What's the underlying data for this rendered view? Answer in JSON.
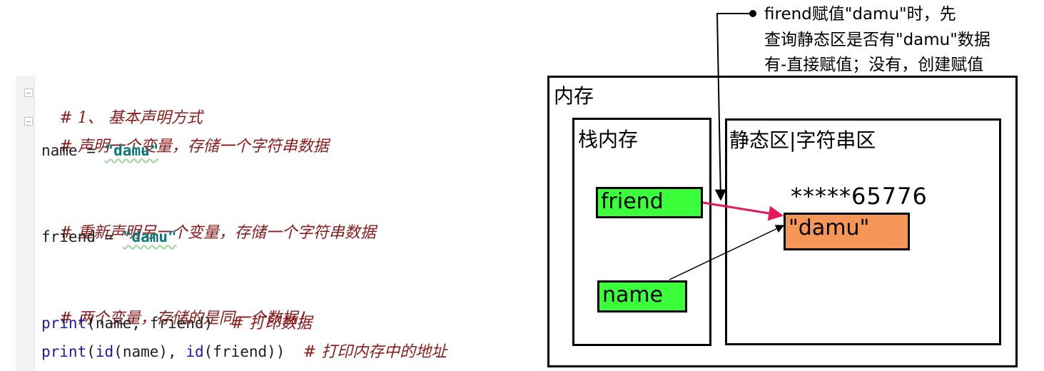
{
  "code": {
    "comment_1": "# 1、 基本声明方式",
    "comment_2": "# 声明一个变量，存储一个字符串数据",
    "line_name": {
      "var": "name",
      "op": " = ",
      "value": "\"damu\""
    },
    "comment_3": "# 重新声明另一个变量，存储一个字符串数据",
    "line_friend": {
      "var": "friend",
      "op": " = ",
      "value": "\"damu\""
    },
    "comment_4": "# 两个变量，存储的是同一个数据！",
    "line_print1": {
      "fn": "print",
      "args": "(name, friend)  ",
      "comment": "# 打印数据"
    },
    "line_print2": {
      "fn": "print",
      "open": "(",
      "fn2": "id",
      "arg1": "(name), ",
      "fn3": "id",
      "arg2": "(friend))  ",
      "comment": "# 打印内存中的地址"
    }
  },
  "diagram": {
    "memory_label": "内存",
    "stack_label": "栈内存",
    "static_label": "静态区|字符串区",
    "var_friend": "friend",
    "var_name": "name",
    "address": "*****65776",
    "value": "\"damu\"",
    "note_lines": [
      "firend赋值\"damu\"时，先",
      "查询静态区是否有\"damu\"数据",
      "有-直接赋值；没有，创建赋值"
    ]
  },
  "colors": {
    "variable_fill": "#3cff3c",
    "value_fill": "#f59556",
    "arrow_highlight": "#e8175d",
    "comment": "#8b1a1a",
    "string": "#0a7a7a",
    "builtin": "#1a1aa6"
  }
}
